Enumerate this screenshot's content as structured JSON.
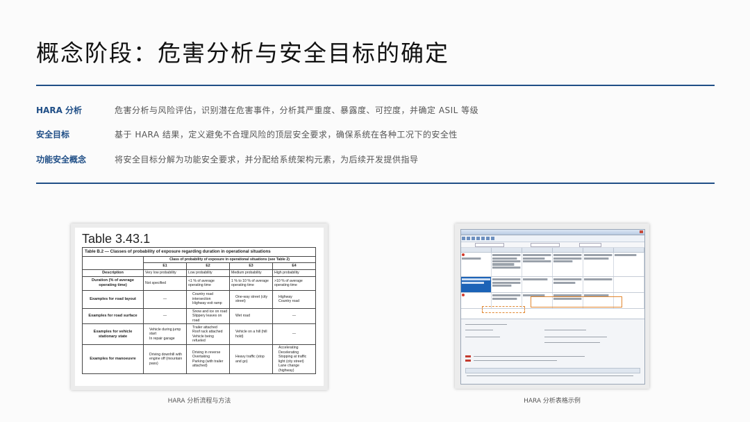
{
  "title": "概念阶段：危害分析与安全目标的确定",
  "rows": [
    {
      "label": "HARA 分析",
      "desc": "危害分析与风险评估，识别潜在危害事件，分析其严重度、暴露度、可控度，并确定 ASIL 等级"
    },
    {
      "label": "安全目标",
      "desc": "基于 HARA 结果，定义避免不合理风险的顶层安全要求，确保系统在各种工况下的安全性"
    },
    {
      "label": "功能安全概念",
      "desc": "将安全目标分解为功能安全要求，并分配给系统架构元素，为后续开发提供指导"
    }
  ],
  "left_figure": {
    "caption": "HARA 分析流程与方法",
    "table_title": "Table 3.43.1",
    "table_caption": "Table B.2 — Classes of probability of exposure regarding duration in operational situations",
    "group_header": "Class of probability of exposure in operational situations (see Table 2)",
    "classes": [
      "E1",
      "E2",
      "E3",
      "E4"
    ],
    "rows": [
      {
        "head": "Description",
        "cells": [
          "Very low probability",
          "Low probability",
          "Medium probability",
          "High probability"
        ]
      },
      {
        "head": "Duration (% of average operating time)",
        "cells": [
          "Not specified",
          "<1 % of average operating time",
          "1 % to 10 % of average operating time",
          ">10 % of average operating time"
        ]
      },
      {
        "head": "Examples for road layout",
        "cells": [
          [
            "—"
          ],
          [
            "Country road intersection",
            "Highway exit ramp"
          ],
          [
            "One-way street (city street)"
          ],
          [
            "Highway",
            "Country road"
          ]
        ]
      },
      {
        "head": "Examples for road surface",
        "cells": [
          [
            "—"
          ],
          [
            "Snow and ice on road",
            "Slippery leaves on road"
          ],
          [
            "Wet road"
          ],
          [
            "—"
          ]
        ]
      },
      {
        "head": "Examples for vehicle stationary state",
        "cells": [
          [
            "Vehicle during jump start",
            "In repair garage"
          ],
          [
            "Trailer attached",
            "Roof rack attached",
            "Vehicle being refueled"
          ],
          [
            "Vehicle on a hill (hill hold)"
          ],
          [
            "—"
          ]
        ]
      },
      {
        "head": "Examples for manoeuvre",
        "cells": [
          [
            "Driving downhill with engine off (mountain pass)"
          ],
          [
            "Driving in reverse",
            "Overtaking",
            "Parking (with trailer attached)"
          ],
          [
            "Heavy traffic (stop and go)"
          ],
          [
            "Accelerating",
            "Decelerating",
            "Stopping at traffic light (city street)",
            "Lane change (highway)"
          ]
        ]
      }
    ]
  },
  "right_figure": {
    "caption": "HARA 分析表格示例"
  },
  "colors": {
    "accent": "#1f4e86",
    "title": "#111111",
    "body": "#555555"
  }
}
